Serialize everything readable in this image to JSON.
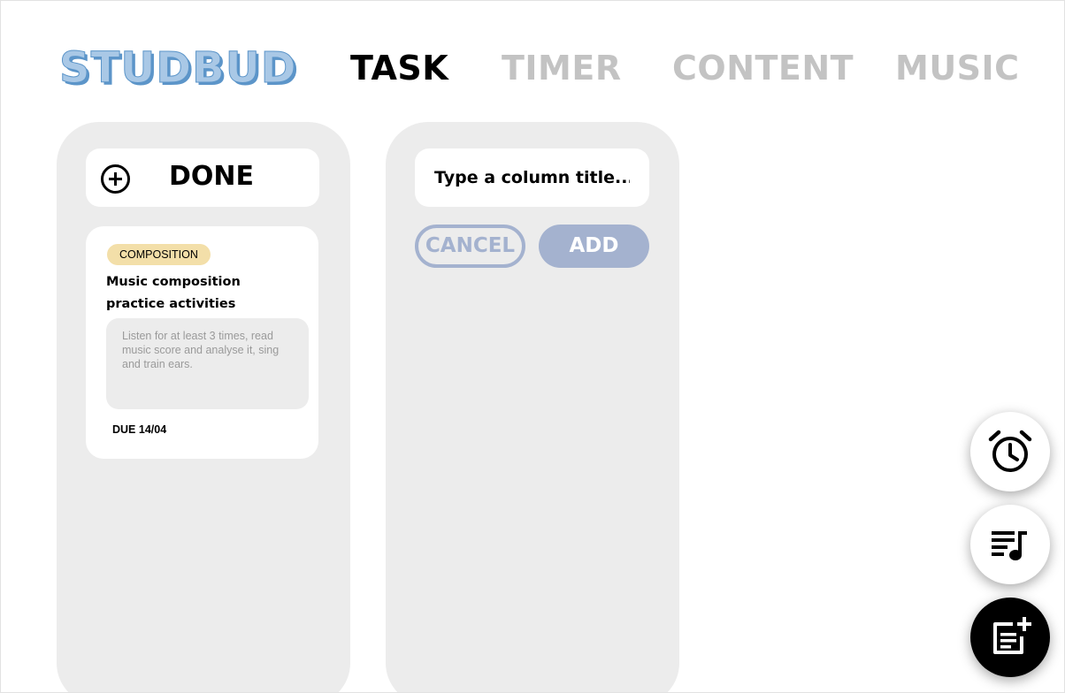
{
  "header": {
    "logo": "STUDBUD",
    "nav": [
      {
        "label": "TASK",
        "active": true
      },
      {
        "label": "TIMER",
        "active": false
      },
      {
        "label": "CONTENT",
        "active": false
      },
      {
        "label": "MUSIC",
        "active": false
      }
    ]
  },
  "columns": {
    "done": {
      "title": "DONE",
      "add_icon": "add-circle-icon",
      "task": {
        "tag": "COMPOSITION",
        "tag_color": "#f3dfa9",
        "title": "Music composition practice activities",
        "description": "Listen for at least 3 times, read music score and analyse it, sing and train ears.",
        "due": "DUE 14/04"
      }
    },
    "new_column": {
      "placeholder": "Type a column title...",
      "value": "",
      "cancel_label": "CANCEL",
      "add_label": "ADD"
    }
  },
  "fabs": {
    "timer_icon": "alarm-clock-icon",
    "music_icon": "playlist-music-icon",
    "add_icon": "note-add-icon"
  },
  "colors": {
    "accent": "#a4b2cf",
    "logo": "#a9c8e6",
    "column_bg": "#ececec",
    "inactive_nav": "#c3c3c3"
  }
}
